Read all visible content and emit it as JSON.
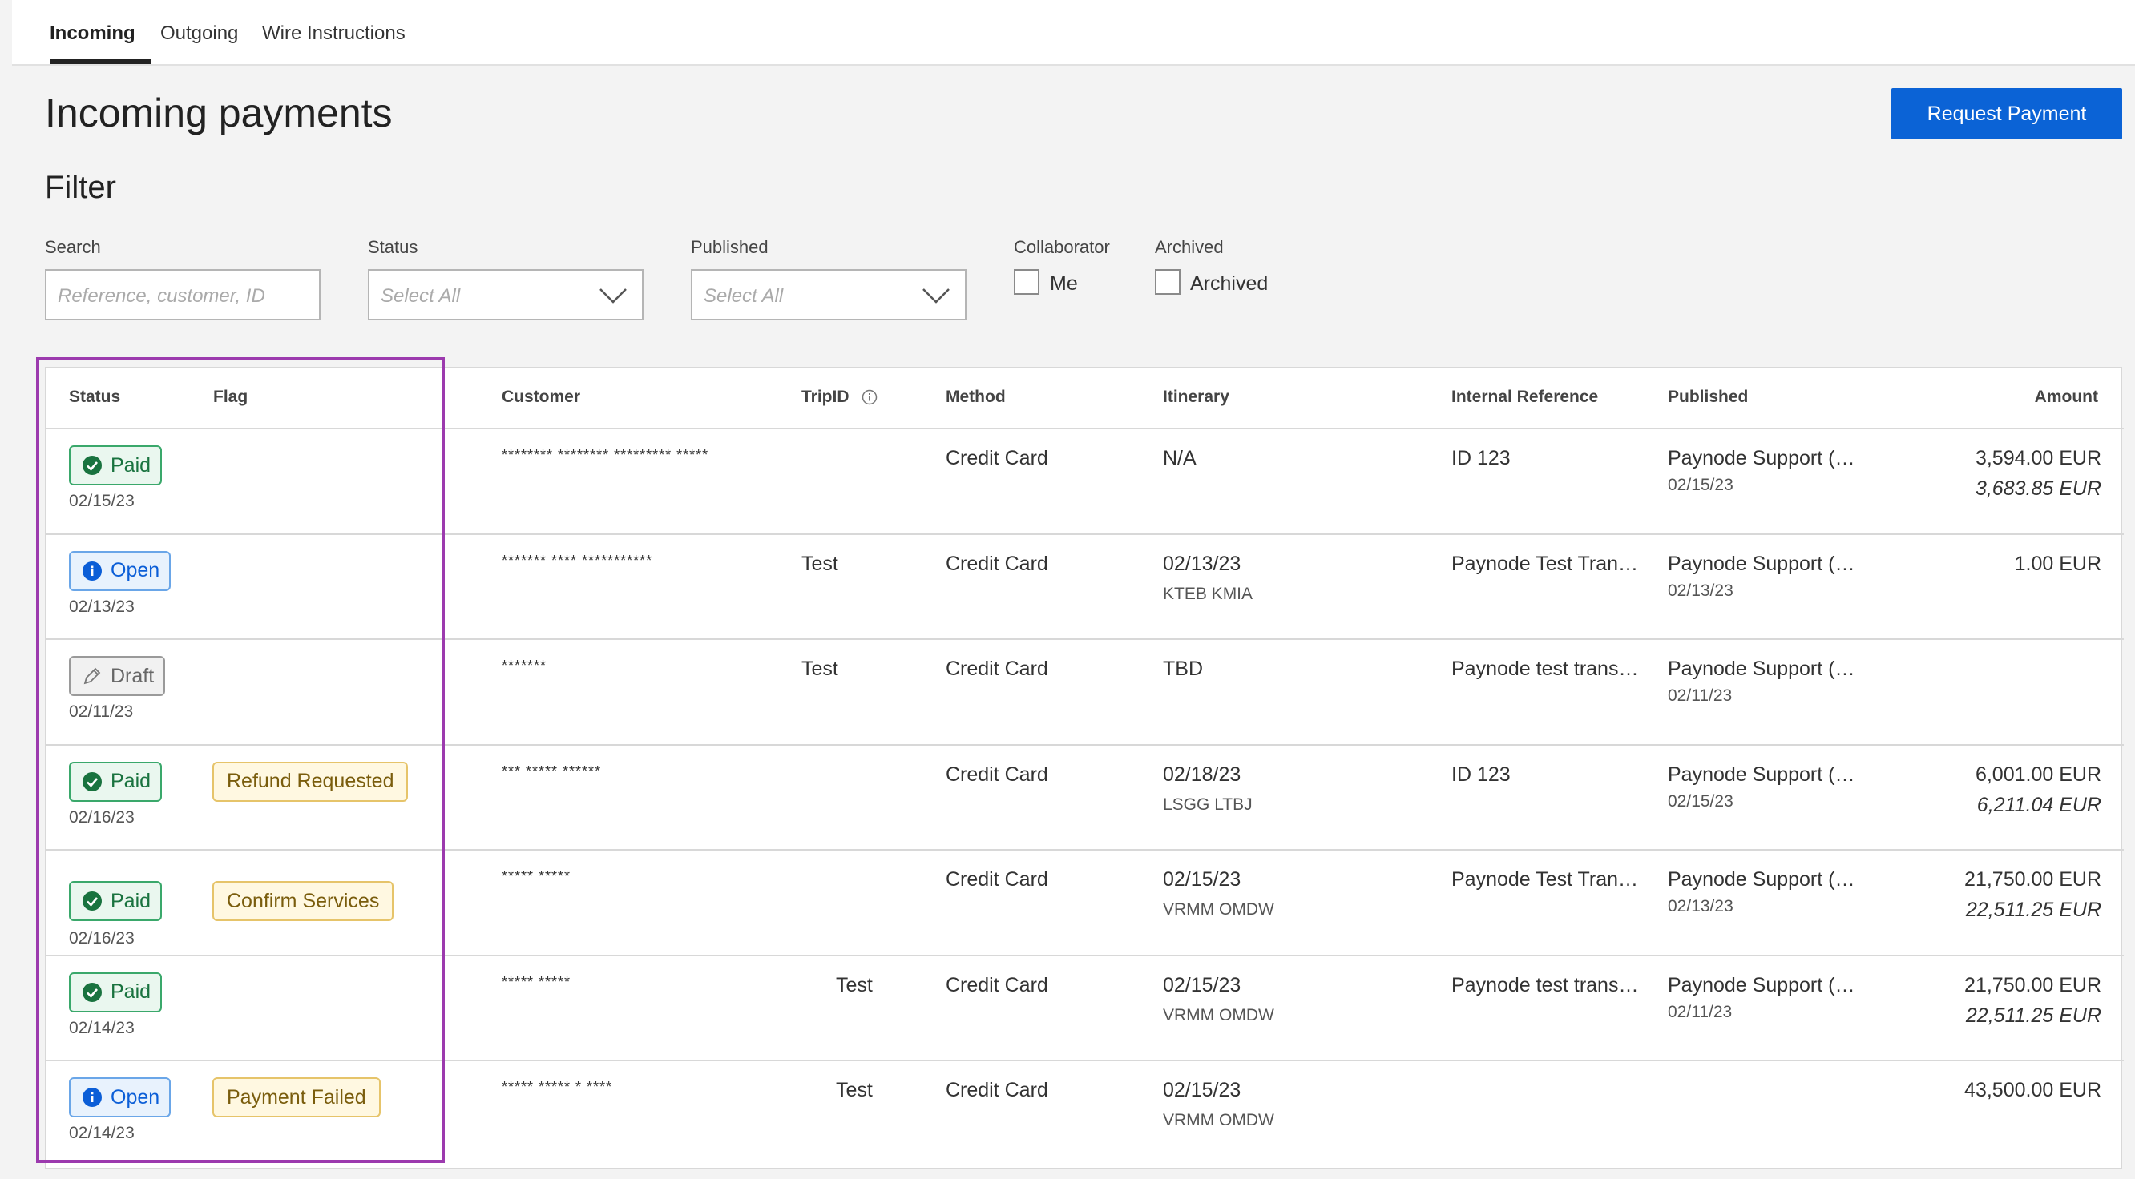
{
  "tabs": [
    "Incoming",
    "Outgoing",
    "Wire Instructions"
  ],
  "page_title": "Incoming payments",
  "request_button": "Request Payment",
  "filter": {
    "title": "Filter",
    "search_label": "Search",
    "search_placeholder": "Reference, customer, ID",
    "status_label": "Status",
    "status_value": "Select All",
    "published_label": "Published",
    "published_value": "Select All",
    "collaborator_label": "Collaborator",
    "collaborator_option": "Me",
    "archived_label": "Archived",
    "archived_option": "Archived"
  },
  "table": {
    "headers": {
      "status": "Status",
      "flag": "Flag",
      "customer": "Customer",
      "tripid": "TripID",
      "method": "Method",
      "itinerary": "Itinerary",
      "internal_ref": "Internal Reference",
      "published": "Published",
      "amount": "Amount"
    },
    "rows": [
      {
        "status": "Paid",
        "date": "02/15/23",
        "flag": "",
        "customer": "******** ******** ********* *****",
        "tripid": "",
        "method": "Credit Card",
        "itin": "N/A",
        "itin_sub": "",
        "ref": "ID 123",
        "pub": "Paynode Support (…",
        "pub_date": "02/15/23",
        "amount": "3,594.00 EUR",
        "amount2": "3,683.85 EUR"
      },
      {
        "status": "Open",
        "date": "02/13/23",
        "flag": "",
        "customer": "******* **** ***********",
        "tripid": "Test",
        "method": "Credit Card",
        "itin": "02/13/23",
        "itin_sub": "KTEB KMIA",
        "ref": "Paynode Test Tran…",
        "pub": "Paynode Support (…",
        "pub_date": "02/13/23",
        "amount": "1.00 EUR",
        "amount2": ""
      },
      {
        "status": "Draft",
        "date": "02/11/23",
        "flag": "",
        "customer": "*******",
        "tripid": "Test",
        "method": "Credit Card",
        "itin": "TBD",
        "itin_sub": "",
        "ref": "Paynode test trans…",
        "pub": "Paynode Support (…",
        "pub_date": "02/11/23",
        "amount": "",
        "amount2": ""
      },
      {
        "status": "Paid",
        "date": "02/16/23",
        "flag": "Refund Requested",
        "customer": "*** ***** ******",
        "tripid": "",
        "method": "Credit Card",
        "itin": "02/18/23",
        "itin_sub": "LSGG LTBJ",
        "ref": "ID 123",
        "pub": "Paynode Support (…",
        "pub_date": "02/15/23",
        "amount": "6,001.00 EUR",
        "amount2": "6,211.04 EUR"
      },
      {
        "status": "Paid",
        "date": "02/16/23",
        "flag": "Confirm Services",
        "customer": "***** *****",
        "tripid": "",
        "method": "Credit Card",
        "itin": "02/15/23",
        "itin_sub": "VRMM OMDW",
        "ref": "Paynode Test Tran…",
        "pub": "Paynode Support (…",
        "pub_date": "02/13/23",
        "amount": "21,750.00 EUR",
        "amount2": "22,511.25 EUR"
      },
      {
        "status": "Paid",
        "date": "02/14/23",
        "flag": "",
        "customer": "***** *****",
        "tripid": "Test",
        "method": "Credit Card",
        "itin": "02/15/23",
        "itin_sub": "VRMM OMDW",
        "ref": "Paynode test trans…",
        "pub": "Paynode Support (…",
        "pub_date": "02/11/23",
        "amount": "21,750.00 EUR",
        "amount2": "22,511.25 EUR"
      },
      {
        "status": "Open",
        "date": "02/14/23",
        "flag": "Payment Failed",
        "customer": "***** ***** * ****",
        "tripid": "Test",
        "method": "Credit Card",
        "itin": "02/15/23",
        "itin_sub": "VRMM OMDW",
        "ref": "",
        "pub": "",
        "pub_date": "",
        "amount": "43,500.00 EUR",
        "amount2": ""
      }
    ]
  },
  "colors": {
    "accent": "#0b63d6",
    "highlight": "#9c3aae",
    "paid": "#19733f",
    "open": "#0b5ed7",
    "flag": "#e6c46a"
  }
}
